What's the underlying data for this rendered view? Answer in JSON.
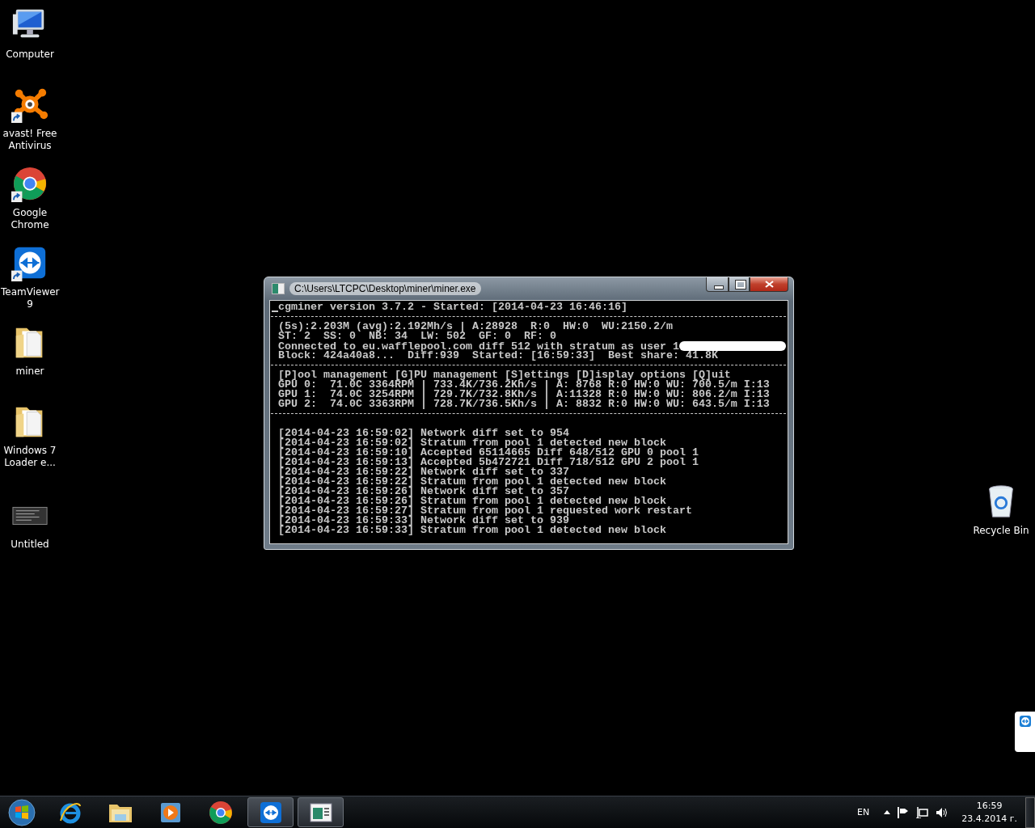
{
  "desktop_icons": [
    {
      "kind": "computer",
      "label": "Computer"
    },
    {
      "kind": "avast",
      "label": "avast! Free Antivirus",
      "shortcut": true
    },
    {
      "kind": "chrome",
      "label": "Google Chrome",
      "shortcut": true
    },
    {
      "kind": "teamviewer",
      "label": "TeamViewer 9",
      "shortcut": true
    },
    {
      "kind": "folder",
      "label": "miner"
    },
    {
      "kind": "folder",
      "label": "Windows 7 Loader e..."
    },
    {
      "kind": "screenshot",
      "label": "Untitled"
    }
  ],
  "recycle_bin": {
    "label": "Recycle Bin"
  },
  "window": {
    "title": "C:\\Users\\LTCPC\\Desktop\\miner\\miner.exe",
    "header": "cgminer version 3.7.2 - Started: [2014-04-23 16:46:16]",
    "status": [
      "(5s):2.203M (avg):2.192Mh/s | A:28928  R:0  HW:0  WU:2150.2/m",
      "ST: 2  SS: 0  NB: 34  LW: 502  GF: 0  RF: 0",
      "Connected to eu.wafflepool.com diff 512 with stratum as user 1",
      "Block: 424a40a8...  Diff:939  Started: [16:59:33]  Best share: 41.8K"
    ],
    "menu": "[P]ool management [G]PU management [S]ettings [D]isplay options [Q]uit",
    "gpus": [
      "GPU 0:  71.0C 3364RPM | 733.4K/736.2Kh/s | A: 8768 R:0 HW:0 WU: 700.5/m I:13",
      "GPU 1:  74.0C 3254RPM | 729.7K/732.8Kh/s | A:11328 R:0 HW:0 WU: 806.2/m I:13",
      "GPU 2:  74.0C 3363RPM | 728.7K/736.5Kh/s | A: 8832 R:0 HW:0 WU: 643.5/m I:13"
    ],
    "log": [
      "[2014-04-23 16:59:02] Network diff set to 954",
      "[2014-04-23 16:59:02] Stratum from pool 1 detected new block",
      "[2014-04-23 16:59:10] Accepted 65114665 Diff 648/512 GPU 0 pool 1",
      "[2014-04-23 16:59:13] Accepted 5b472721 Diff 718/512 GPU 2 pool 1",
      "[2014-04-23 16:59:22] Network diff set to 337",
      "[2014-04-23 16:59:22] Stratum from pool 1 detected new block",
      "[2014-04-23 16:59:26] Network diff set to 357",
      "[2014-04-23 16:59:26] Stratum from pool 1 detected new block",
      "[2014-04-23 16:59:27] Stratum from pool 1 requested work restart",
      "[2014-04-23 16:59:33] Network diff set to 939",
      "[2014-04-23 16:59:33] Stratum from pool 1 detected new block"
    ]
  },
  "taskbar": {
    "items": [
      {
        "kind": "ie",
        "active": false
      },
      {
        "kind": "explorer",
        "active": false
      },
      {
        "kind": "media",
        "active": false
      },
      {
        "kind": "chrome",
        "active": false
      },
      {
        "kind": "teamviewer",
        "active": true
      },
      {
        "kind": "console",
        "active": true
      }
    ],
    "language": "EN",
    "time": "16:59",
    "date": "23.4.2014 г."
  }
}
